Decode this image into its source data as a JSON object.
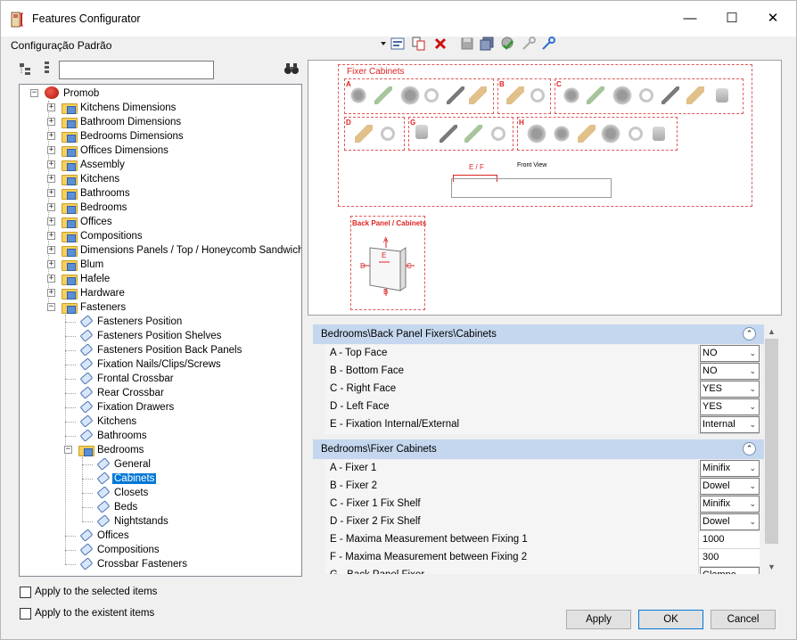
{
  "window": {
    "title": "Features Configurator",
    "minimize_glyph": "—",
    "maximize_glyph": "☐",
    "close_glyph": "✕"
  },
  "config": {
    "label": "Configuração Padrão"
  },
  "toolbar": {
    "icons": [
      "dropdown-arrow-icon",
      "properties-icon",
      "copy-icon",
      "delete-icon",
      "save-icon",
      "save-all-icon",
      "settings-check-icon",
      "key-gray-icon",
      "key-blue-icon"
    ]
  },
  "search": {
    "value": "",
    "placeholder": ""
  },
  "tree": {
    "root": "Promob",
    "items": [
      {
        "label": "Kitchens Dimensions"
      },
      {
        "label": "Bathroom Dimensions"
      },
      {
        "label": "Bedrooms Dimensions"
      },
      {
        "label": "Offices Dimensions"
      },
      {
        "label": "Assembly"
      },
      {
        "label": "Kitchens"
      },
      {
        "label": "Bathrooms"
      },
      {
        "label": "Bedrooms"
      },
      {
        "label": "Offices"
      },
      {
        "label": "Compositions"
      },
      {
        "label": "Dimensions Panels / Top / Honeycomb Sandwich"
      },
      {
        "label": "Blum"
      },
      {
        "label": "Hafele"
      },
      {
        "label": "Hardware"
      },
      {
        "label": "Fasteners"
      }
    ],
    "fasteners": [
      {
        "label": "Fasteners Position"
      },
      {
        "label": "Fasteners Position Shelves"
      },
      {
        "label": "Fasteners Position Back Panels"
      },
      {
        "label": "Fixation Nails/Clips/Screws"
      },
      {
        "label": "Frontal Crossbar"
      },
      {
        "label": "Rear Crossbar"
      },
      {
        "label": "Fixation Drawers"
      },
      {
        "label": "Kitchens"
      },
      {
        "label": "Bathrooms"
      },
      {
        "label": "Bedrooms"
      }
    ],
    "bedrooms": [
      {
        "label": "General"
      },
      {
        "label": "Cabinets",
        "selected": true
      },
      {
        "label": "Closets"
      },
      {
        "label": "Beds"
      },
      {
        "label": "Nightstands"
      }
    ],
    "tail": [
      {
        "label": "Offices"
      },
      {
        "label": "Compositions"
      },
      {
        "label": "Crossbar Fasteners"
      }
    ]
  },
  "preview": {
    "fixer_title": "Fixer Cabinets",
    "groups": [
      "A",
      "B",
      "C",
      "D",
      "G",
      "H"
    ],
    "ef_label": "E / F",
    "front_view": "Front View",
    "back_title": "Back Panel / Cabinets",
    "back_letters": {
      "a": "A",
      "b": "B",
      "c": "C",
      "d": "D",
      "e": "E"
    }
  },
  "sections": [
    {
      "title": "Bedrooms\\Back Panel Fixers\\Cabinets",
      "rows": [
        {
          "name": "A - Top Face",
          "value": "NO",
          "combo": true
        },
        {
          "name": "B - Bottom Face",
          "value": "NO",
          "combo": true
        },
        {
          "name": "C - Right Face",
          "value": "YES",
          "combo": true
        },
        {
          "name": "D - Left Face",
          "value": "YES",
          "combo": true
        },
        {
          "name": "E - Fixation Internal/External",
          "value": "Internal",
          "combo": true
        }
      ]
    },
    {
      "title": "Bedrooms\\Fixer Cabinets",
      "rows": [
        {
          "name": "A - Fixer 1",
          "value": "Minifix",
          "combo": true
        },
        {
          "name": "B - Fixer 2",
          "value": "Dowel",
          "combo": true
        },
        {
          "name": "C - Fixer 1 Fix Shelf",
          "value": "Minifix",
          "combo": true
        },
        {
          "name": "D - Fixer 2 Fix Shelf",
          "value": "Dowel",
          "combo": true
        },
        {
          "name": "E - Maxima Measurement between Fixing 1",
          "value": "1000",
          "combo": false
        },
        {
          "name": "F - Maxima Measurement between Fixing 2",
          "value": "300",
          "combo": false
        },
        {
          "name": "G - Back Panel Fixer",
          "value": "Clampe",
          "combo": true
        }
      ]
    }
  ],
  "bottom": {
    "apply_selected": "Apply to the selected items",
    "apply_existent": "Apply to the existent items",
    "apply_btn": "Apply",
    "ok_btn": "OK",
    "cancel_btn": "Cancel"
  }
}
